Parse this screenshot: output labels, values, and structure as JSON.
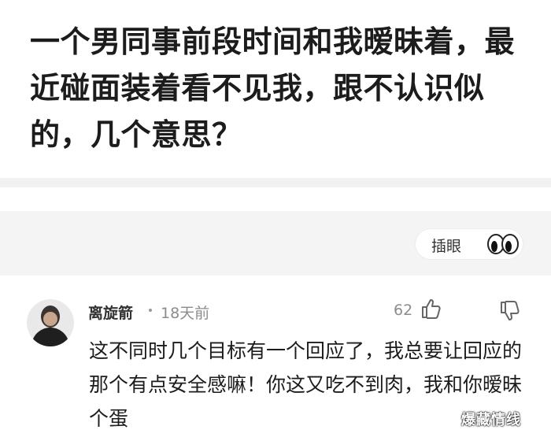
{
  "question": {
    "title": "一个男同事前段时间和我暧昧着，最近碰面装着看不见我，跟不认识似的，几个意思？"
  },
  "actions": {
    "peek_label": "插眼",
    "peek_icon": "eyes-icon"
  },
  "comment": {
    "author": "离旋箭",
    "time": "18天前",
    "like_count": "62",
    "like_icon": "thumbs-up-icon",
    "dislike_icon": "thumbs-down-icon",
    "text": "这不同时几个目标有一个回应了，我总要让回应的那个有点安全感嘛！你这又吃不到肉，我和你暧昧个蛋"
  },
  "watermark": "爆藏情线"
}
